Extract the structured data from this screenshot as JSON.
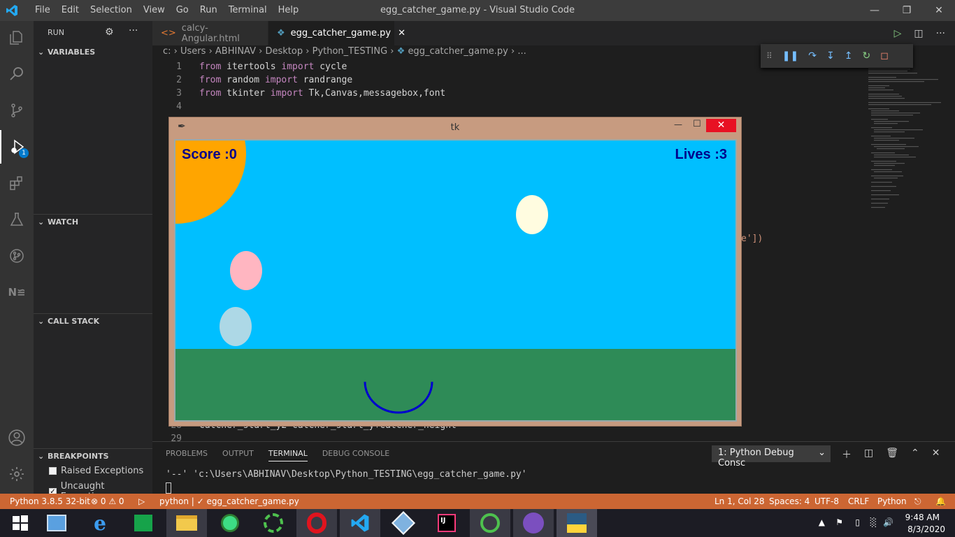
{
  "window": {
    "title": "egg_catcher_game.py - Visual Studio Code"
  },
  "menu": [
    "File",
    "Edit",
    "Selection",
    "View",
    "Go",
    "Run",
    "Terminal",
    "Help"
  ],
  "sidebar": {
    "title": "RUN",
    "sections": {
      "variables": "VARIABLES",
      "watch": "WATCH",
      "call_stack": "CALL STACK",
      "breakpoints": "BREAKPOINTS"
    },
    "breakpoints": [
      {
        "label": "Raised Exceptions",
        "checked": false
      },
      {
        "label": "Uncaught Exceptio...",
        "checked": true
      }
    ],
    "debug_badge": "1"
  },
  "tabs": [
    {
      "label": "calcy-Angular.html",
      "active": false
    },
    {
      "label": "egg_catcher_game.py",
      "active": true
    }
  ],
  "breadcrumb": [
    "c:",
    "Users",
    "ABHINAV",
    "Desktop",
    "Python_TESTING",
    "egg_catcher_game.py",
    "..."
  ],
  "editor": {
    "lines": [
      {
        "n": "1",
        "parts": [
          [
            "kw",
            "from"
          ],
          [
            "t",
            " itertools "
          ],
          [
            "kw",
            "import"
          ],
          [
            "t",
            " cycle"
          ]
        ]
      },
      {
        "n": "2",
        "parts": [
          [
            "kw",
            "from"
          ],
          [
            "t",
            " random "
          ],
          [
            "kw",
            "import"
          ],
          [
            "t",
            " randrange"
          ]
        ]
      },
      {
        "n": "3",
        "parts": [
          [
            "kw",
            "from"
          ],
          [
            "t",
            " tkinter "
          ],
          [
            "kw",
            "import"
          ],
          [
            "t",
            " Tk,Canvas,messagebox,font"
          ]
        ]
      },
      {
        "n": "4",
        "parts": []
      }
    ],
    "fragment_right": "e'])",
    "line28_no": "28",
    "line28_text": "catcher_start_y2=catcher_start_y+catcher_height",
    "line29_no": "29"
  },
  "tk_window": {
    "title": "tk",
    "score": "Score :0",
    "lives": "Lives :3",
    "colors": {
      "sky": "#00bfff",
      "grass": "#2e8b57",
      "sun": "#ffa500",
      "catcher": "#0000cd",
      "text": "#00008b"
    },
    "eggs": [
      "#fffce0",
      "#ffb6c1",
      "#add8e6"
    ]
  },
  "panel": {
    "tabs": [
      "PROBLEMS",
      "OUTPUT",
      "TERMINAL",
      "DEBUG CONSOLE"
    ],
    "active_tab": "TERMINAL",
    "terminal_select": "1: Python Debug Consc",
    "terminal_output": "'--' 'c:\\Users\\ABHINAV\\Desktop\\Python_TESTING\\egg_catcher_game.py'"
  },
  "status": {
    "interpreter": "Python 3.8.5 32-bit",
    "errors": "⊗ 0 ⚠ 0",
    "run": "python | ✓ egg_catcher_game.py",
    "position": "Ln 1, Col 28",
    "spaces": "Spaces: 4",
    "encoding": "UTF-8",
    "eol": "CRLF",
    "language": "Python",
    "color": "#cc6633"
  },
  "taskbar": {
    "time": "9:48 AM",
    "date": "8/3/2020"
  }
}
